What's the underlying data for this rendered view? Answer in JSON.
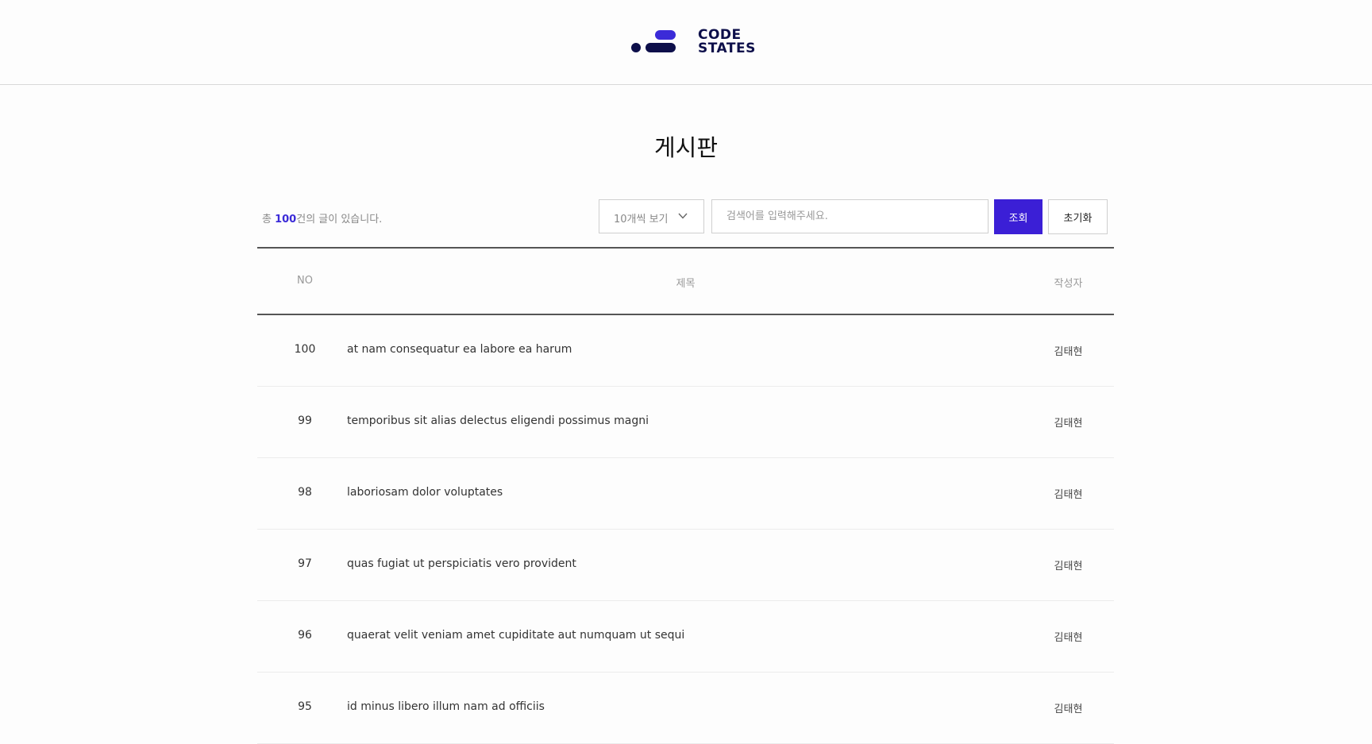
{
  "header": {
    "logo_line1": "CODE",
    "logo_line2": "STATES",
    "brand_color": "#0d0f4a",
    "accent_color": "#3b2bd8"
  },
  "page": {
    "title": "게시판"
  },
  "toolbar": {
    "total_prefix": "총 ",
    "total_count": "100",
    "total_suffix": "건의 글이 있습니다.",
    "page_size_selected": "10개씩 보기",
    "search_placeholder": "검색어를 입력해주세요.",
    "search_value": "",
    "search_button_label": "조회",
    "reset_button_label": "초기화"
  },
  "table": {
    "columns": {
      "no": "NO",
      "title": "제목",
      "author": "작성자"
    },
    "rows": [
      {
        "no": "100",
        "title": "at nam consequatur ea labore ea harum",
        "author": "김태현"
      },
      {
        "no": "99",
        "title": "temporibus sit alias delectus eligendi possimus magni",
        "author": "김태현"
      },
      {
        "no": "98",
        "title": "laboriosam dolor voluptates",
        "author": "김태현"
      },
      {
        "no": "97",
        "title": "quas fugiat ut perspiciatis vero provident",
        "author": "김태현"
      },
      {
        "no": "96",
        "title": "quaerat velit veniam amet cupiditate aut numquam ut sequi",
        "author": "김태현"
      },
      {
        "no": "95",
        "title": "id minus libero illum nam ad officiis",
        "author": "김태현"
      }
    ]
  }
}
